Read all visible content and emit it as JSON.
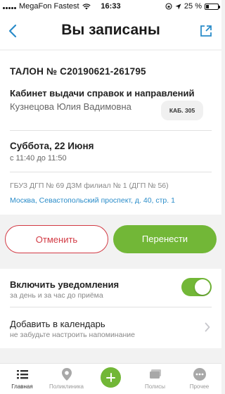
{
  "status_bar": {
    "carrier": "MegaFon Fastest",
    "time": "16:33",
    "battery": "25 %",
    "battery_level": 0.25
  },
  "nav": {
    "title": "Вы записаны"
  },
  "ticket": {
    "label": "ТАЛОН № С20190621-261795"
  },
  "appointment": {
    "cabinet": "Кабинет выдачи справок и направлений",
    "doctor": "Кузнецова Юлия Вадимовна",
    "room": "КАБ. 305",
    "date": "Суббота, 22 Июня",
    "time_range": "с 11:40 до 11:50",
    "clinic": "ГБУЗ ДГП № 69 ДЗМ филиал № 1 (ДГП № 56)",
    "address": "Москва, Севастопольский проспект, д. 40, стр. 1"
  },
  "actions": {
    "cancel": "Отменить",
    "reschedule": "Перенести"
  },
  "settings": {
    "notifications_title": "Включить уведомления",
    "notifications_sub": "за день и за час до приёма",
    "notifications_on": true,
    "calendar_title": "Добавить в календарь",
    "calendar_sub": "не забудьте настроить напоминание"
  },
  "tabs": [
    {
      "label": "Главная",
      "icon": "list-icon"
    },
    {
      "label": "Поликлиника",
      "icon": "location-pin-icon"
    },
    {
      "label": "",
      "icon": "plus-icon"
    },
    {
      "label": "Полисы",
      "icon": "cards-icon"
    },
    {
      "label": "Прочее",
      "icon": "more-icon"
    }
  ],
  "colors": {
    "accent_green": "#72b737",
    "cancel_red": "#d23a44",
    "link_blue": "#2a8cc9",
    "nav_blue": "#2a8cc9"
  }
}
